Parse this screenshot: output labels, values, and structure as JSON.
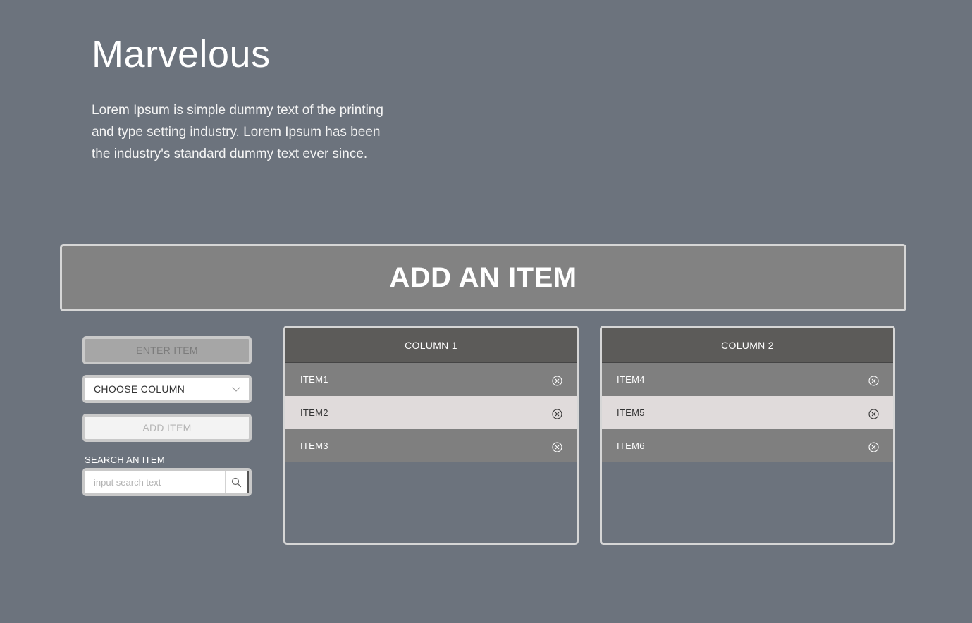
{
  "hero": {
    "title": "Marvelous",
    "text": "Lorem Ipsum is simple dummy text of the printing and type setting industry. Lorem Ipsum has been the industry's standard dummy text ever since."
  },
  "banner": {
    "title": "ADD AN ITEM"
  },
  "form": {
    "enter_item_placeholder": "ENTER ITEM",
    "choose_column_label": "CHOOSE COLUMN",
    "add_item_label": "ADD ITEM",
    "search_label": "SEARCH AN ITEM",
    "search_placeholder": "input search text"
  },
  "columns": [
    {
      "title": "COLUMN 1",
      "items": [
        "ITEM1",
        "ITEM2",
        "ITEM3"
      ]
    },
    {
      "title": "COLUMN 2",
      "items": [
        "ITEM4",
        "ITEM5",
        "ITEM6"
      ]
    }
  ],
  "icons": {
    "dropdown": "chevron-down-icon",
    "search": "search-icon",
    "remove": "close-circle-icon"
  },
  "colors": {
    "background": "#6c737d",
    "banner": "#828282",
    "column_header": "#5c5b59",
    "row_dark": "#7f7f7f",
    "row_light": "#e0dbdb"
  }
}
